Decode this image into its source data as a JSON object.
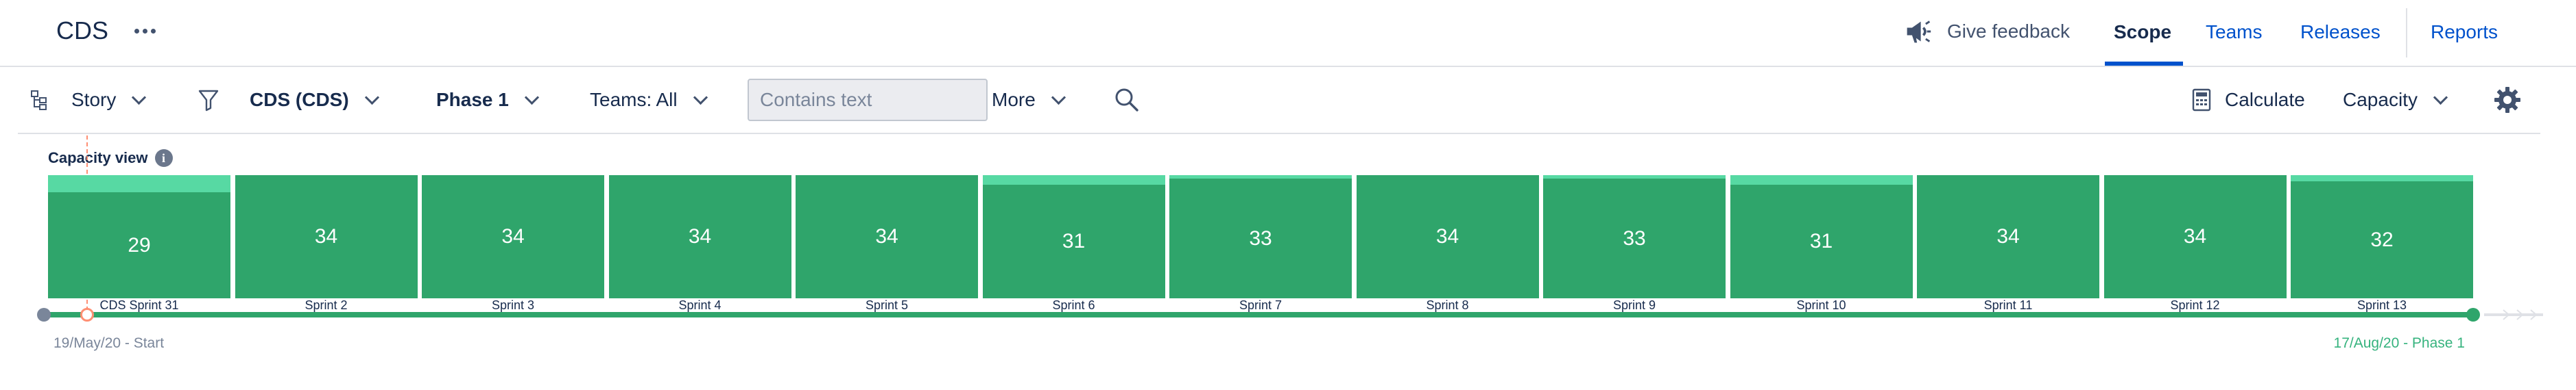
{
  "header": {
    "title": "CDS",
    "feedback_label": "Give feedback",
    "tabs": [
      {
        "label": "Scope",
        "active": true
      },
      {
        "label": "Teams",
        "active": false
      },
      {
        "label": "Releases",
        "active": false
      },
      {
        "label": "Reports",
        "active": false
      }
    ]
  },
  "toolbar": {
    "hierarchy_label": "Story",
    "filter_label": "CDS (CDS)",
    "phase_label": "Phase 1",
    "teams_label": "Teams: All",
    "search_placeholder": "Contains text",
    "more_label": "More",
    "calculate_label": "Calculate",
    "capacity_label": "Capacity"
  },
  "capacity_view": {
    "label": "Capacity view",
    "info_icon": "i",
    "sprints": [
      {
        "name": "CDS Sprint 31",
        "value": "29",
        "fill": 0.86
      },
      {
        "name": "Sprint 2",
        "value": "34",
        "fill": 1.0
      },
      {
        "name": "Sprint 3",
        "value": "34",
        "fill": 1.0
      },
      {
        "name": "Sprint 4",
        "value": "34",
        "fill": 1.0
      },
      {
        "name": "Sprint 5",
        "value": "34",
        "fill": 1.0
      },
      {
        "name": "Sprint 6",
        "value": "31",
        "fill": 0.92
      },
      {
        "name": "Sprint 7",
        "value": "33",
        "fill": 0.97
      },
      {
        "name": "Sprint 8",
        "value": "34",
        "fill": 1.0
      },
      {
        "name": "Sprint 9",
        "value": "33",
        "fill": 0.97
      },
      {
        "name": "Sprint 10",
        "value": "31",
        "fill": 0.92
      },
      {
        "name": "Sprint 11",
        "value": "34",
        "fill": 1.0
      },
      {
        "name": "Sprint 12",
        "value": "34",
        "fill": 1.0
      },
      {
        "name": "Sprint 13",
        "value": "32",
        "fill": 0.95
      }
    ],
    "start_date": "19/May/20 - Start",
    "end_date": "17/Aug/20 - Phase 1"
  },
  "colors": {
    "accent": "#0052cc",
    "capacity_used": "#2fa56b",
    "capacity_remaining": "#57d9a3",
    "today_marker": "#ff8f73"
  },
  "icons": [
    "more-icon",
    "megaphone-icon",
    "hierarchy-icon",
    "filter-icon",
    "chevron-down-icon",
    "search-icon",
    "calculator-icon",
    "gear-icon",
    "info-icon"
  ]
}
